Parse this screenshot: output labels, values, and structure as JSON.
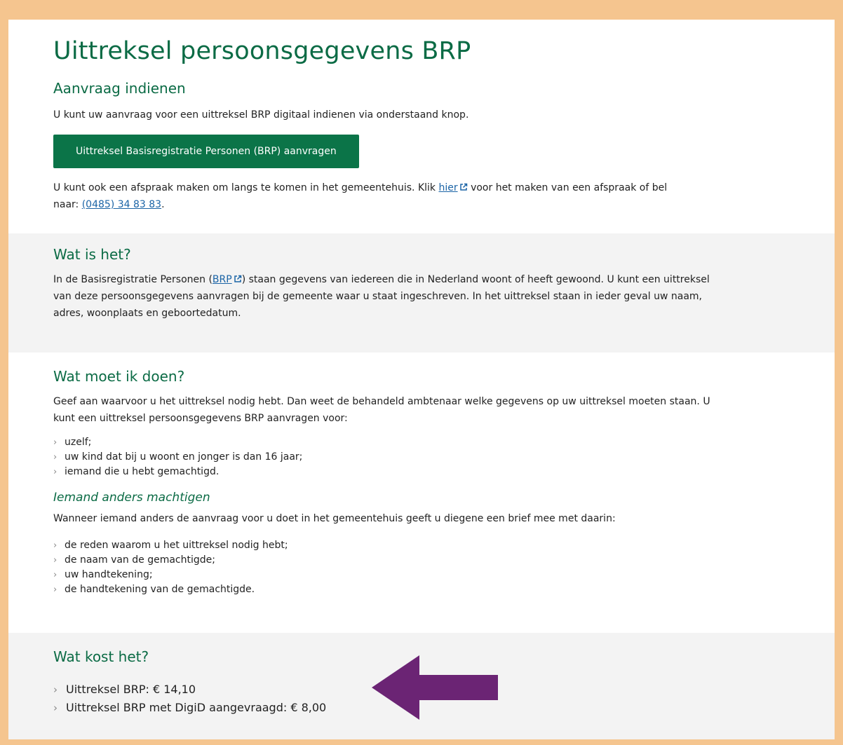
{
  "page": {
    "title": "Uittreksel persoonsgegevens BRP"
  },
  "aanvraag": {
    "heading": "Aanvraag indienen",
    "intro": "U kunt uw aanvraag voor een uittreksel BRP digitaal indienen via onderstaand knop.",
    "button_label": "Uittreksel Basisregistratie Personen (BRP) aanvragen",
    "afspraak_text_before": "U kunt ook een afspraak maken om langs te komen in het gemeentehuis. Klik ",
    "afspraak_link": "hier",
    "afspraak_text_middle": " voor het maken van een afspraak of bel",
    "afspraak_text_naar": "naar: ",
    "phone": "(0485) 34 83 83",
    "afspraak_text_end": "."
  },
  "wat_is_het": {
    "heading": "Wat is het?",
    "text_before": "In de Basisregistratie Personen (",
    "brp_link": "BRP",
    "text_after_line1": ") staan gegevens van iedereen die in Nederland woont of heeft gewoond. U kunt een uittreksel",
    "line2": "van deze persoonsgegevens aanvragen bij de gemeente waar u staat ingeschreven. In het uittreksel staan in ieder geval uw naam,",
    "line3": "adres, woonplaats en geboortedatum."
  },
  "wat_moet_ik_doen": {
    "heading": "Wat moet ik doen?",
    "line1": "Geef aan waarvoor u het uittreksel nodig hebt. Dan weet de behandeld ambtenaar welke gegevens op uw uittreksel moeten staan. U",
    "line2": "kunt een uittreksel persoonsgegevens BRP aanvragen voor:",
    "items": [
      "uzelf;",
      "uw kind dat bij u woont en jonger is dan 16 jaar;",
      "iemand die u hebt gemachtigd."
    ],
    "sub_heading": "Iemand anders machtigen",
    "sub_text": "Wanneer iemand anders de aanvraag voor u doet in het gemeentehuis geeft u diegene een brief mee met daarin:",
    "sub_items": [
      "de reden waarom u het uittreksel nodig hebt;",
      "de naam van de gemachtigde;",
      "uw handtekening;",
      "de handtekening van de gemachtigde."
    ]
  },
  "kosten": {
    "heading": "Wat kost het?",
    "items": [
      "Uittreksel BRP: € 14,10",
      "Uittreksel BRP met DigiD aangevraagd: € 8,00"
    ]
  },
  "colors": {
    "frame": "#f5c58f",
    "heading_green": "#0b6b45",
    "button_green": "#0b7448",
    "link_blue": "#1b64a6",
    "arrow_purple": "#6b2474",
    "section_gray": "#f3f3f3"
  },
  "icons": {
    "external_link": "external-link-icon",
    "chevron": "chevron-right-icon",
    "annotation_arrow": "left-arrow-annotation"
  }
}
